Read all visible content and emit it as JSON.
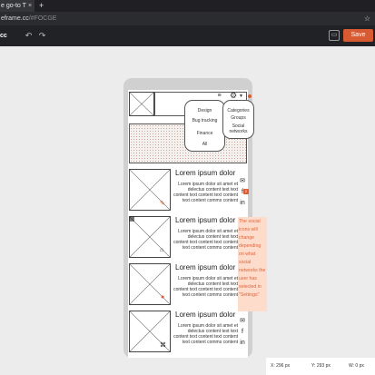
{
  "browser": {
    "tab_title": "e go-to T",
    "tab_close": "×",
    "new_tab": "+",
    "address_main": "eframe.cc",
    "address_dim": "/#FOCGE",
    "star_icon": "☆"
  },
  "toolbar": {
    "logo": "cc",
    "undo_icon": "↶",
    "redo_icon": "↷",
    "comment_icon": "▭",
    "save_label": "Save",
    "save_color": "#d75a32"
  },
  "header": {
    "filter_icon": "≡",
    "gear_icon": "⚙",
    "chevron_icon": "▼"
  },
  "dropdowns": {
    "categories": [
      "Design",
      "Bug tracking",
      "Finance",
      "All"
    ],
    "types": [
      "Categories",
      "Groups",
      "Social networks"
    ]
  },
  "cards": [
    {
      "title": "Lorem ipsum dolor",
      "text": "Lorem ipsum dolor sit amet et delectus content text text content text content text content text content comms content"
    },
    {
      "title": "Lorem ipsum dolor",
      "text": "Lorem ipsum dolor sit amet et delectus content text text content text content text content text content comms content"
    },
    {
      "title": "Lorem ipsum dolor",
      "text": "Lorem ipsum dolor sit amet et delectus content text text content text content text content text content comms content"
    },
    {
      "title": "Lorem ipsum dolor",
      "text": "Lorem ipsum dolor sit amet et delectus content text text content text content text content text content comms content"
    }
  ],
  "notification_count": "2",
  "note": "The social icons will change depending on what social networks the user has selected in \"Settings\"",
  "status": {
    "x": "X: 296 px",
    "y": "Y: 293 px",
    "w": "W: 0 px"
  },
  "colors": {
    "accent": "#d75a32",
    "note_bg": "#fddccb",
    "note_text": "#e2633a"
  }
}
